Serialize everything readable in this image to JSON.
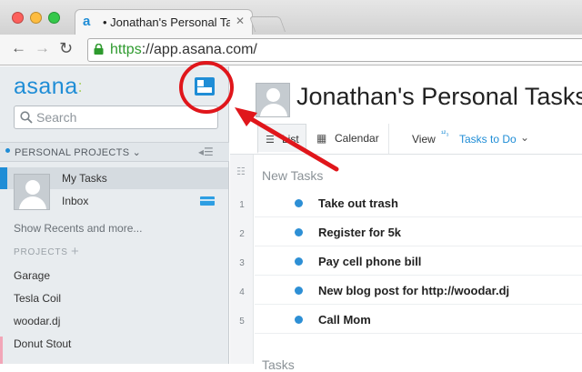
{
  "browser": {
    "tab_title": "• Jonathan's Personal Task",
    "tab_favicon": "a",
    "tab_close": "✕",
    "url_scheme": "https",
    "url_rest": "://app.asana.com/",
    "colors": {
      "close": "#fc605c",
      "minimize": "#fdbc40",
      "zoom": "#34c84a"
    }
  },
  "sidebar": {
    "logo": "asana",
    "search_placeholder": "Search",
    "personal_projects_label": "PERSONAL PROJECTS ⌄",
    "my_tasks": "My Tasks",
    "inbox": "Inbox",
    "show_recents": "Show Recents and more...",
    "projects_label": "PROJECTS",
    "projects_add": "+",
    "projects": [
      "Garage",
      "Tesla Coil",
      "woodar.dj",
      "Donut Stout"
    ]
  },
  "main": {
    "title": "Jonathan's Personal Tasks",
    "tabs": {
      "list": "List",
      "calendar": "Calendar"
    },
    "view_label": "View",
    "view_value": "Tasks to Do",
    "section_new": "New Tasks",
    "section_tasks": "Tasks",
    "tasks": [
      {
        "num": "1",
        "text": "Take out trash"
      },
      {
        "num": "2",
        "text": "Register for 5k"
      },
      {
        "num": "3",
        "text": "Pay cell phone bill"
      },
      {
        "num": "4",
        "text": "New blog post for http://woodar.dj"
      },
      {
        "num": "5",
        "text": "Call Mom"
      }
    ]
  },
  "icons": {
    "back": "back-arrow-icon",
    "forward": "forward-arrow-icon",
    "reload": "reload-icon",
    "lock": "lock-icon",
    "search": "search-icon",
    "toggle": "sidebar-toggle-icon",
    "inbox": "inbox-icon",
    "list": "list-icon",
    "calendar": "calendar-icon"
  },
  "accent_color": "#1f8dd6",
  "annotation_color": "#e0161b"
}
